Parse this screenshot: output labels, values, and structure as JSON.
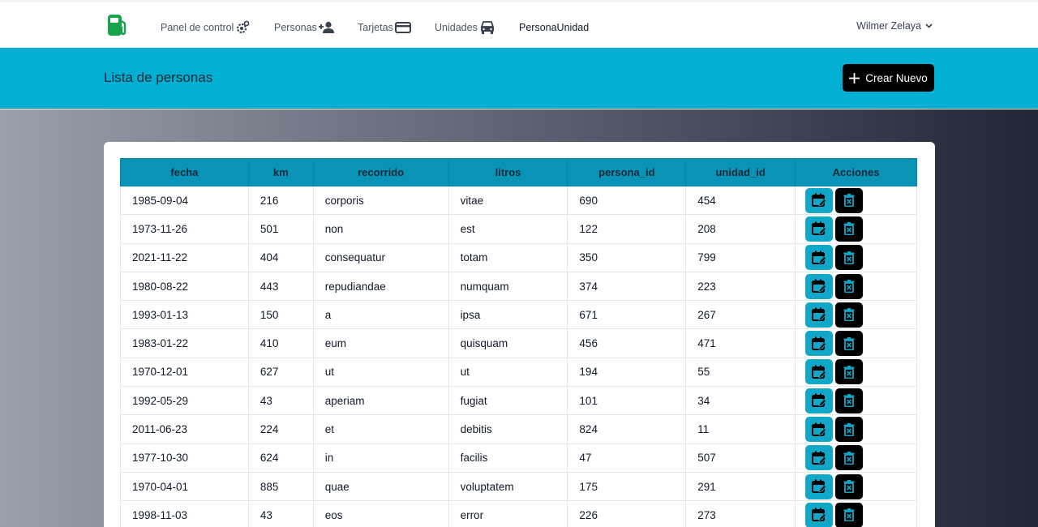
{
  "nav": {
    "items": [
      {
        "label": "Panel de control",
        "icon": "gear-icon"
      },
      {
        "label": "Personas",
        "icon": "person-add-icon"
      },
      {
        "label": "Tarjetas",
        "icon": "credit-card-icon"
      },
      {
        "label": "Unidades",
        "icon": "car-icon"
      },
      {
        "label": "PersonaUnidad",
        "icon": ""
      }
    ],
    "active": "PersonaUnidad",
    "user": "Wilmer Zelaya"
  },
  "header": {
    "title": "Lista de personas",
    "create_label": "Crear Nuevo"
  },
  "colors": {
    "brand": "#16a34a",
    "band": "#00afd2",
    "table_header": "#0893b7",
    "edit_button": "#10a7c9",
    "delete_button": "#000000"
  },
  "table": {
    "columns": [
      "fecha",
      "km",
      "recorrido",
      "litros",
      "persona_id",
      "unidad_id",
      "Acciones"
    ],
    "rows": [
      [
        "1985-09-04",
        "216",
        "corporis",
        "vitae",
        "690",
        "454"
      ],
      [
        "1973-11-26",
        "501",
        "non",
        "est",
        "122",
        "208"
      ],
      [
        "2021-11-22",
        "404",
        "consequatur",
        "totam",
        "350",
        "799"
      ],
      [
        "1980-08-22",
        "443",
        "repudiandae",
        "numquam",
        "374",
        "223"
      ],
      [
        "1993-01-13",
        "150",
        "a",
        "ipsa",
        "671",
        "267"
      ],
      [
        "1983-01-22",
        "410",
        "eum",
        "quisquam",
        "456",
        "471"
      ],
      [
        "1970-12-01",
        "627",
        "ut",
        "ut",
        "194",
        "55"
      ],
      [
        "1992-05-29",
        "43",
        "aperiam",
        "fugiat",
        "101",
        "34"
      ],
      [
        "2011-06-23",
        "224",
        "et",
        "debitis",
        "824",
        "11"
      ],
      [
        "1977-10-30",
        "624",
        "in",
        "facilis",
        "47",
        "507"
      ],
      [
        "1970-04-01",
        "885",
        "quae",
        "voluptatem",
        "175",
        "291"
      ],
      [
        "1998-11-03",
        "43",
        "eos",
        "error",
        "226",
        "273"
      ]
    ]
  }
}
